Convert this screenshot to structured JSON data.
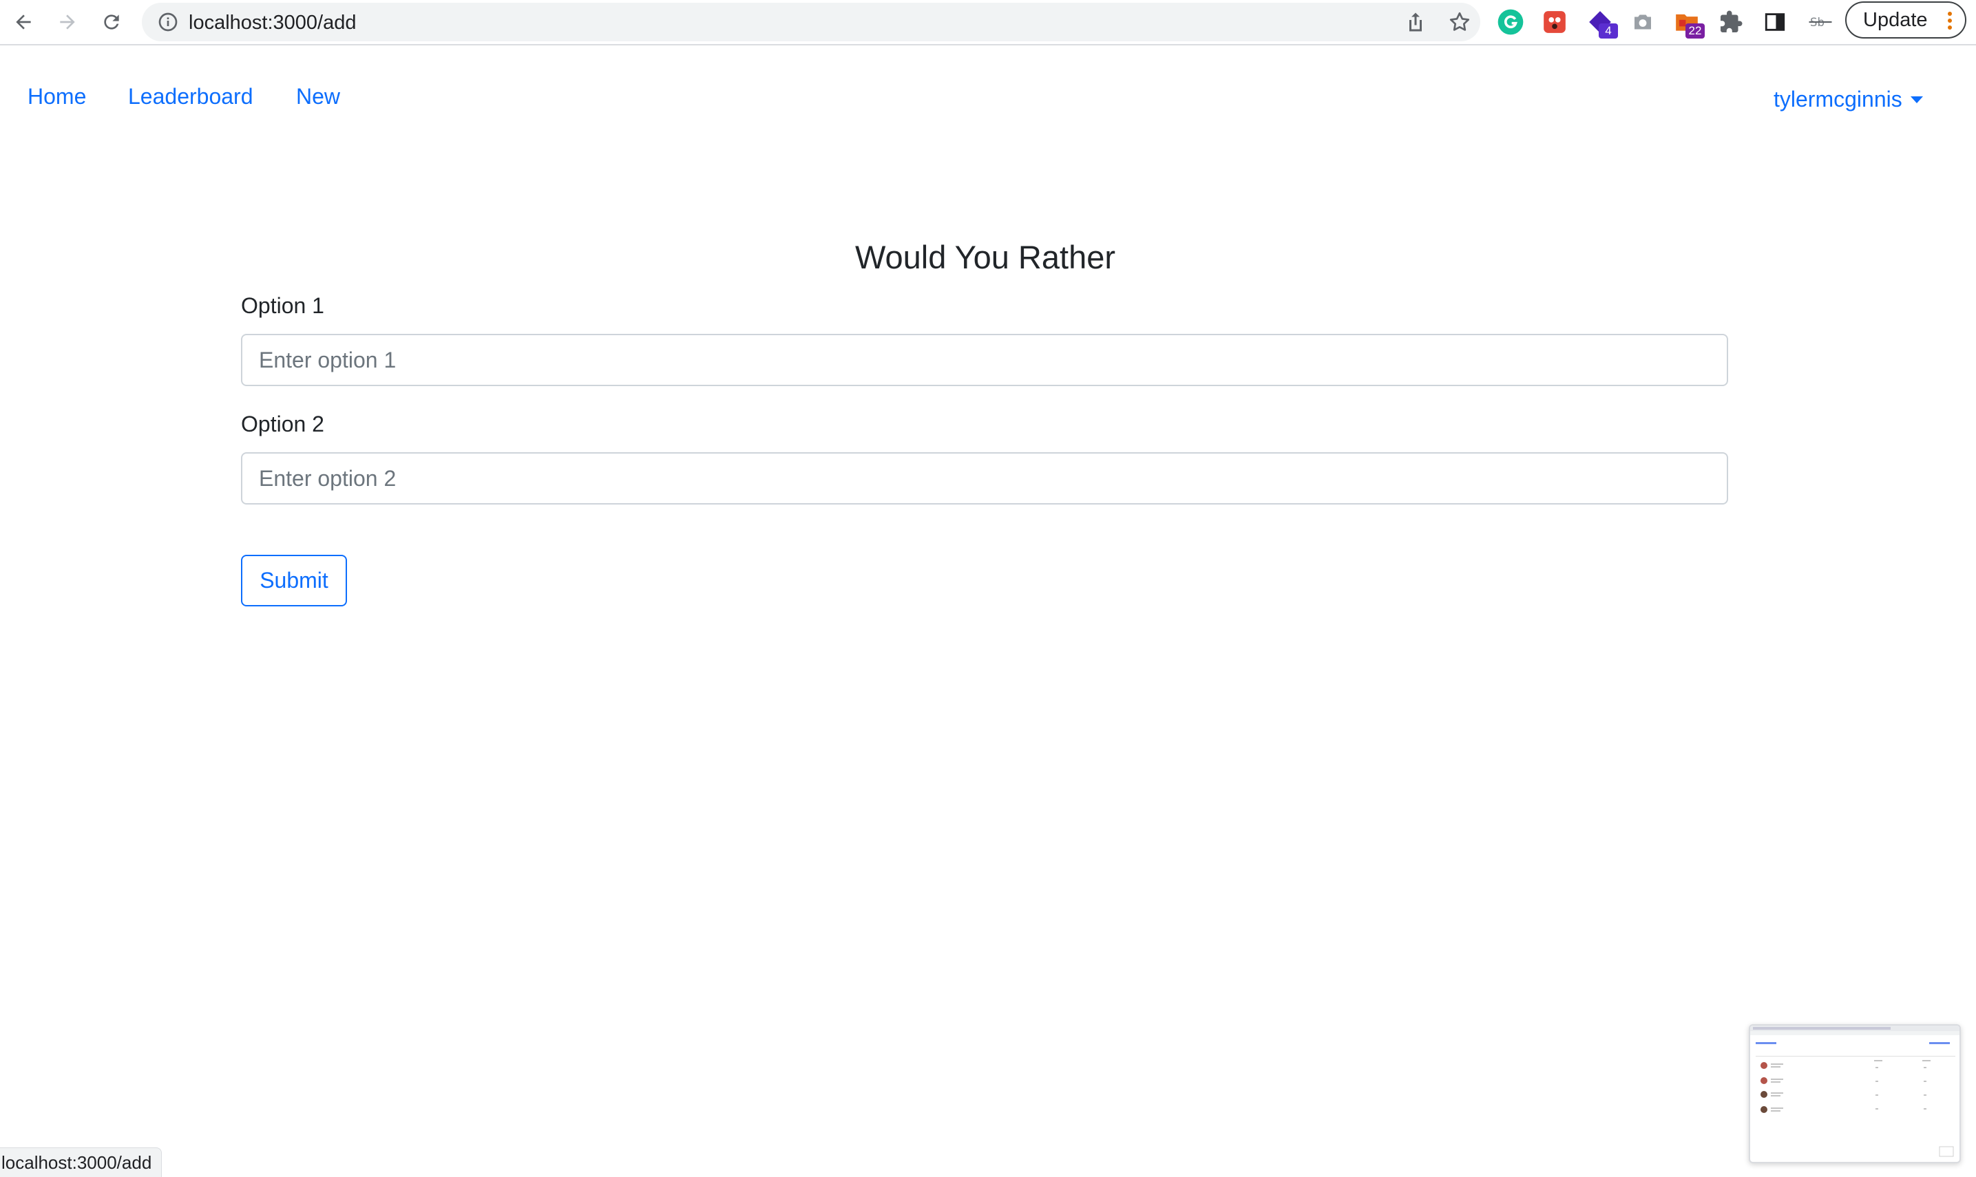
{
  "browser": {
    "url": "localhost:3000/add",
    "update_label": "Update",
    "extensions": [
      {
        "name": "grammarly-icon",
        "color": "#15c39a"
      },
      {
        "name": "ladybug-extension-icon",
        "color": "#e5493a"
      },
      {
        "name": "purple-extension-icon",
        "color": "#4b1fb8",
        "badge": "4"
      },
      {
        "name": "camera-icon",
        "color": "#80868b"
      },
      {
        "name": "folder-extension-icon",
        "color": "#d93025",
        "badge": "22"
      },
      {
        "name": "puzzle-icon",
        "color": "#5f6368"
      },
      {
        "name": "side-panel-icon",
        "color": "#202124"
      },
      {
        "name": "strikethrough-extension-icon",
        "color": "#80868b"
      }
    ]
  },
  "nav": {
    "home": "Home",
    "leaderboard": "Leaderboard",
    "new": "New",
    "user": "tylermcginnis"
  },
  "form": {
    "title": "Would You Rather",
    "option1_label": "Option 1",
    "option1_placeholder": "Enter option 1",
    "option1_value": "",
    "option2_label": "Option 2",
    "option2_placeholder": "Enter option 2",
    "option2_value": "",
    "submit_label": "Submit"
  },
  "status_bar": {
    "text": "localhost:3000/add"
  },
  "colors": {
    "link": "#0d6efd",
    "text": "#212529",
    "input_border": "#ced4da",
    "placeholder": "#6c757d"
  }
}
